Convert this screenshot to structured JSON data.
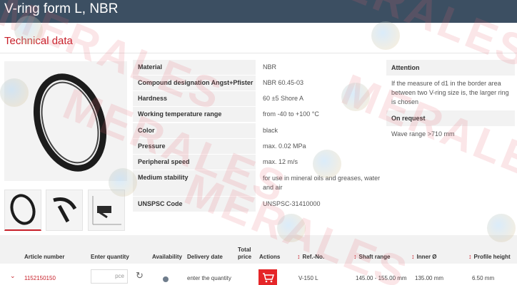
{
  "page": {
    "title": "V-ring form L, NBR",
    "section_title": "Technical data"
  },
  "specs": [
    {
      "label": "Material",
      "value": "NBR"
    },
    {
      "label": "Compound designation Angst+Pfister",
      "value": "NBR 60.45-03"
    },
    {
      "label": "Hardness",
      "value": "60 ±5 Shore A"
    },
    {
      "label": "Working temperature range",
      "value": "from -40 to +100 °C"
    },
    {
      "label": "Color",
      "value": "black"
    },
    {
      "label": "Pressure",
      "value": "max. 0.02 MPa"
    },
    {
      "label": "Peripheral speed",
      "value": "max. 12 m/s"
    },
    {
      "label": "Medium stability",
      "value": "for use in mineral oils and greases, water and air"
    },
    {
      "label": "UNSPSC Code",
      "value": "UNSPSC-31410000"
    }
  ],
  "side": {
    "attention_heading": "Attention",
    "attention_text": "If the measure of d1 in the border area between two V-ring size is, the larger ring is chosen",
    "request_heading": "On request",
    "request_text": "Wave range >710 mm"
  },
  "table": {
    "headers": {
      "article_number": "Article number",
      "enter_quantity": "Enter quantity",
      "availability": "Availability",
      "delivery_date": "Delivery date",
      "total_price": "Total price",
      "actions": "Actions",
      "ref_no": "Ref.-No.",
      "shaft_range": "Shaft range",
      "inner": "Inner Ø",
      "profile_height": "Profile height"
    },
    "row": {
      "article_number": "1152150150",
      "quantity_placeholder": "pce",
      "delivery_date": "enter the quantity",
      "ref_no": "V-150 L",
      "shaft_range": "145.00 - 155.00 mm",
      "inner": "135.00 mm",
      "profile_height": "6.50 mm"
    }
  },
  "watermark": "MERALES",
  "colors": {
    "header_bg": "#3c4f62",
    "accent": "#c8202a",
    "cart_button": "#e52528",
    "availability_dot": "#6f7d8c"
  }
}
